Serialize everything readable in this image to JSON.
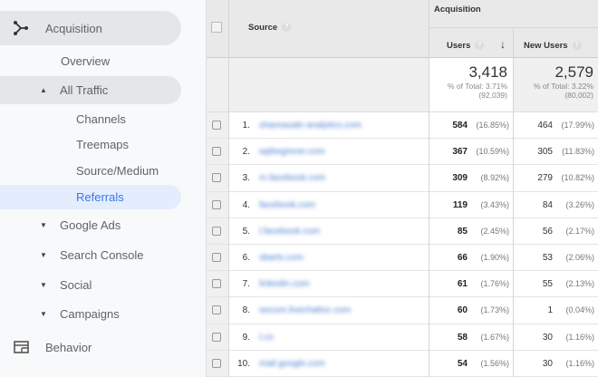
{
  "sidebar": {
    "acquisition": "Acquisition",
    "overview": "Overview",
    "all_traffic": "All Traffic",
    "channels": "Channels",
    "treemaps": "Treemaps",
    "source_medium": "Source/Medium",
    "referrals": "Referrals",
    "google_ads": "Google Ads",
    "search_console": "Search Console",
    "social": "Social",
    "campaigns": "Campaigns",
    "behavior": "Behavior"
  },
  "table": {
    "source_header": "Source",
    "group_header": "Acquisition",
    "users_header": "Users",
    "new_users_header": "New Users",
    "help": "?",
    "sort_icon": "↓",
    "totals": {
      "users": "3,418",
      "users_pct": "% of Total: 3.71%",
      "users_of": "(92,039)",
      "new_users": "2,579",
      "new_users_pct": "% of Total: 3.22%",
      "new_users_of": "(80,002)"
    },
    "rows": [
      {
        "idx": "1.",
        "source": "shareasale-analytics.com",
        "users": "584",
        "users_pct": "(16.85%)",
        "new": "464",
        "new_pct": "(17.99%)"
      },
      {
        "idx": "2.",
        "source": "wpbeginner.com",
        "users": "367",
        "users_pct": "(10.59%)",
        "new": "305",
        "new_pct": "(11.83%)"
      },
      {
        "idx": "3.",
        "source": "m.facebook.com",
        "users": "309",
        "users_pct": "(8.92%)",
        "new": "279",
        "new_pct": "(10.82%)"
      },
      {
        "idx": "4.",
        "source": "facebook.com",
        "users": "119",
        "users_pct": "(3.43%)",
        "new": "84",
        "new_pct": "(3.26%)"
      },
      {
        "idx": "5.",
        "source": "l.facebook.com",
        "users": "85",
        "users_pct": "(2.45%)",
        "new": "56",
        "new_pct": "(2.17%)"
      },
      {
        "idx": "6.",
        "source": "sbarts.com",
        "users": "66",
        "users_pct": "(1.90%)",
        "new": "53",
        "new_pct": "(2.06%)"
      },
      {
        "idx": "7.",
        "source": "linkedin.com",
        "users": "61",
        "users_pct": "(1.76%)",
        "new": "55",
        "new_pct": "(2.13%)"
      },
      {
        "idx": "8.",
        "source": "secure.livechatinc.com",
        "users": "60",
        "users_pct": "(1.73%)",
        "new": "1",
        "new_pct": "(0.04%)"
      },
      {
        "idx": "9.",
        "source": "t.co",
        "users": "58",
        "users_pct": "(1.67%)",
        "new": "30",
        "new_pct": "(1.16%)"
      },
      {
        "idx": "10.",
        "source": "mail.google.com",
        "users": "54",
        "users_pct": "(1.56%)",
        "new": "30",
        "new_pct": "(1.16%)"
      }
    ]
  }
}
